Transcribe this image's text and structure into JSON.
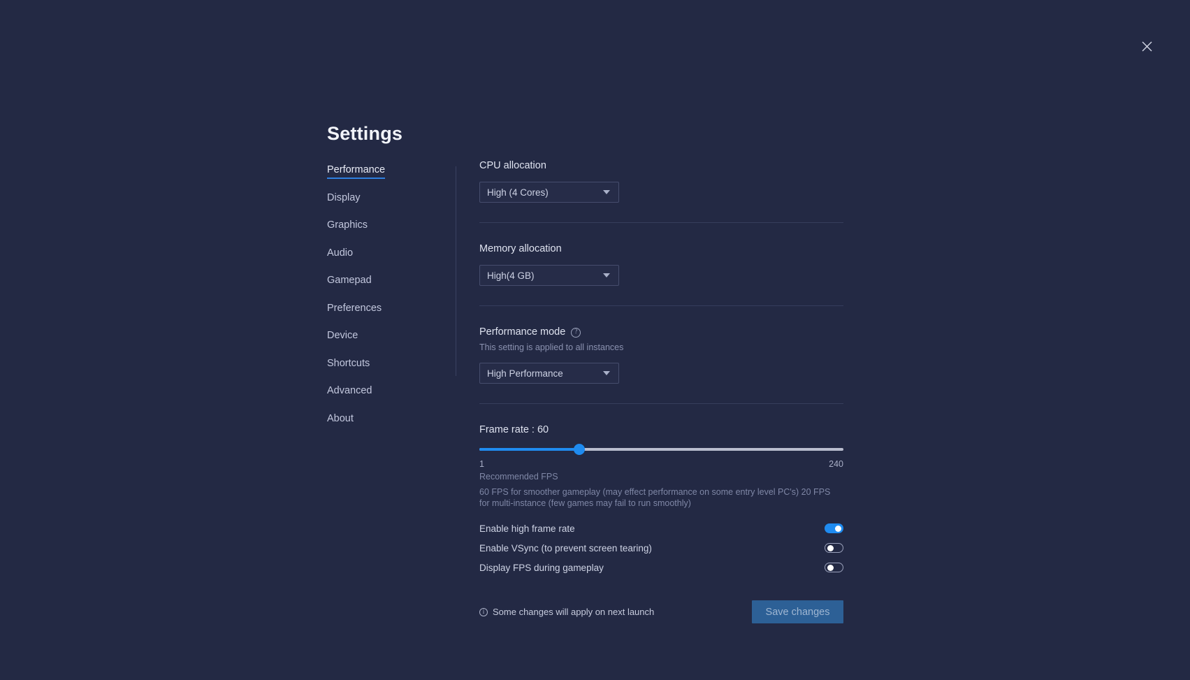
{
  "window": {
    "close_label": "×",
    "background_color": "#232944",
    "accent_color": "#1f8bf0"
  },
  "page_title": "Settings",
  "sidebar": {
    "items": [
      {
        "label": "Performance",
        "active": true
      },
      {
        "label": "Display",
        "active": false
      },
      {
        "label": "Graphics",
        "active": false
      },
      {
        "label": "Audio",
        "active": false
      },
      {
        "label": "Gamepad",
        "active": false
      },
      {
        "label": "Preferences",
        "active": false
      },
      {
        "label": "Device",
        "active": false
      },
      {
        "label": "Shortcuts",
        "active": false
      },
      {
        "label": "Advanced",
        "active": false
      },
      {
        "label": "About",
        "active": false
      }
    ]
  },
  "main": {
    "cpu": {
      "label": "CPU allocation",
      "value": "High (4 Cores)"
    },
    "memory": {
      "label": "Memory allocation",
      "value": "High(4 GB)"
    },
    "performance_mode": {
      "label": "Performance mode",
      "help_glyph": "?",
      "note": "This setting is applied to all instances",
      "value": "High Performance"
    },
    "frame_rate": {
      "label": "Frame rate : 60",
      "value": 60,
      "min": 1,
      "max": 240,
      "min_label": "1",
      "max_label": "240",
      "fill_percent": 27.5,
      "recommended_title": "Recommended FPS",
      "recommended_body": "60 FPS for smoother gameplay (may effect performance on some entry level PC's) 20 FPS for multi-instance (few games may fail to run smoothly)"
    },
    "toggles": [
      {
        "label": "Enable high frame rate",
        "on": true
      },
      {
        "label": "Enable VSync (to prevent screen tearing)",
        "on": false
      },
      {
        "label": "Display FPS during gameplay",
        "on": false
      }
    ],
    "footer": {
      "info_glyph": "i",
      "note": "Some changes will apply on next launch",
      "save_label": "Save changes"
    }
  }
}
